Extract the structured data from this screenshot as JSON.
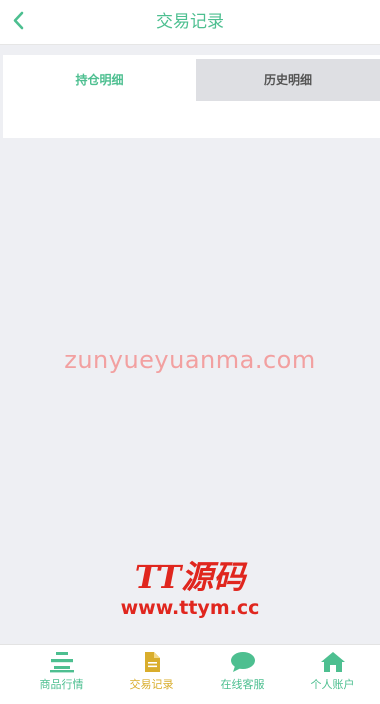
{
  "header": {
    "title": "交易记录",
    "back_icon": "chevron-left-icon"
  },
  "tabs": [
    {
      "label": "持仓明细",
      "active": true
    },
    {
      "label": "历史明细",
      "active": false
    }
  ],
  "watermark": {
    "url_text": "zunyueyuanma.com",
    "logo_line1": "TT源码",
    "logo_line2": "www.ttym.cc"
  },
  "bottom_nav": [
    {
      "label": "商品行情",
      "icon": "market-list-icon",
      "color": "#4dbf90",
      "active": false
    },
    {
      "label": "交易记录",
      "icon": "document-icon",
      "color": "#d9ad2c",
      "active": true
    },
    {
      "label": "在线客服",
      "icon": "chat-bubble-icon",
      "color": "#4dbf90",
      "active": false
    },
    {
      "label": "个人账户",
      "icon": "home-icon",
      "color": "#4dbf90",
      "active": false
    }
  ],
  "colors": {
    "accent": "#4dbf90",
    "active_nav": "#d9ad2c",
    "background": "#eeeff3",
    "watermark": "#f2a0a0",
    "logo": "#e0261e"
  }
}
